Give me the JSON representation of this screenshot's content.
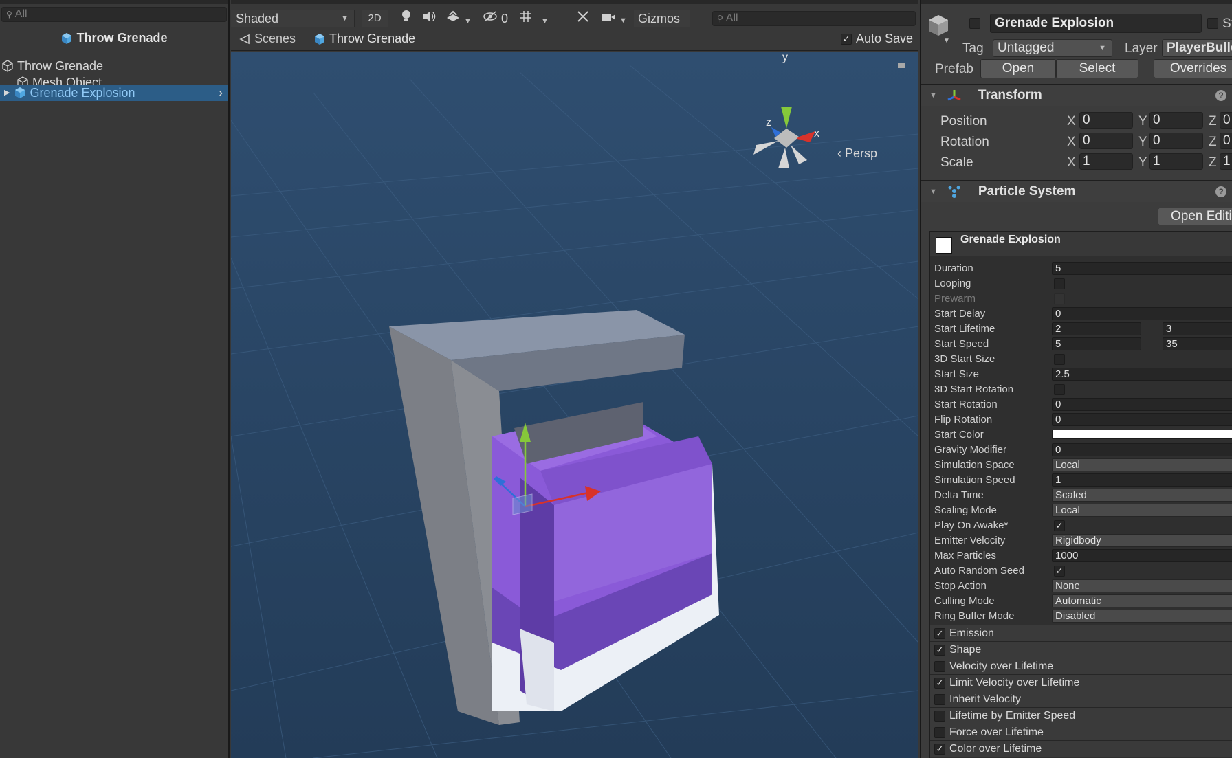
{
  "hierarchy": {
    "search_placeholder": "All",
    "prefab_title": "Throw Grenade",
    "items": [
      {
        "label": "Throw Grenade"
      },
      {
        "label": "Mesh Object"
      },
      {
        "label": "Grenade Explosion"
      }
    ]
  },
  "scene": {
    "shading_mode": "Shaded",
    "mode_2d": "2D",
    "hidden_count": "0",
    "gizmos_label": "Gizmos",
    "search_placeholder": "All",
    "breadcrumb": {
      "root": "Scenes",
      "current": "Throw Grenade"
    },
    "auto_save_label": "Auto Save",
    "projection_label": "Persp",
    "axis_labels": {
      "x": "x",
      "y": "y",
      "z": "z"
    }
  },
  "inspector": {
    "object_name": "Grenade Explosion",
    "static_label_partial": "St",
    "tag_label": "Tag",
    "tag_value": "Untagged",
    "layer_label": "Layer",
    "layer_value": "PlayerBulle",
    "prefab_label": "Prefab",
    "prefab_buttons": {
      "open": "Open",
      "select": "Select",
      "overrides": "Overrides"
    },
    "transform": {
      "title": "Transform",
      "rows": [
        {
          "label": "Position",
          "x": "0",
          "y": "0",
          "z": "0"
        },
        {
          "label": "Rotation",
          "x": "0",
          "y": "0",
          "z": "0"
        },
        {
          "label": "Scale",
          "x": "1",
          "y": "1",
          "z": "1"
        }
      ],
      "axis": {
        "x": "X",
        "y": "Y",
        "z": "Z"
      }
    },
    "particle_system": {
      "title": "Particle System",
      "open_editor": "Open Editi",
      "panel_title": "Grenade Explosion",
      "fields": {
        "duration": {
          "label": "Duration",
          "value": "5"
        },
        "looping": {
          "label": "Looping"
        },
        "prewarm": {
          "label": "Prewarm"
        },
        "start_delay": {
          "label": "Start Delay",
          "value": "0"
        },
        "start_lifetime": {
          "label": "Start Lifetime",
          "min": "2",
          "max": "3"
        },
        "start_speed": {
          "label": "Start Speed",
          "min": "5",
          "max": "35"
        },
        "start_size_3d": {
          "label": "3D Start Size"
        },
        "start_size": {
          "label": "Start Size",
          "value": "2.5"
        },
        "start_rotation_3d": {
          "label": "3D Start Rotation"
        },
        "start_rotation": {
          "label": "Start Rotation",
          "value": "0"
        },
        "flip_rotation": {
          "label": "Flip Rotation",
          "value": "0"
        },
        "start_color": {
          "label": "Start Color",
          "color": "#ffffff"
        },
        "gravity_modifier": {
          "label": "Gravity Modifier",
          "value": "0"
        },
        "simulation_space": {
          "label": "Simulation Space",
          "value": "Local"
        },
        "simulation_speed": {
          "label": "Simulation Speed",
          "value": "1"
        },
        "delta_time": {
          "label": "Delta Time",
          "value": "Scaled"
        },
        "scaling_mode": {
          "label": "Scaling Mode",
          "value": "Local"
        },
        "play_on_awake": {
          "label": "Play On Awake*"
        },
        "emitter_velocity": {
          "label": "Emitter Velocity",
          "value": "Rigidbody"
        },
        "max_particles": {
          "label": "Max Particles",
          "value": "1000"
        },
        "auto_random_seed": {
          "label": "Auto Random Seed"
        },
        "stop_action": {
          "label": "Stop Action",
          "value": "None"
        },
        "culling_mode": {
          "label": "Culling Mode",
          "value": "Automatic"
        },
        "ring_buffer_mode": {
          "label": "Ring Buffer Mode",
          "value": "Disabled"
        }
      },
      "modules": [
        {
          "label": "Emission",
          "enabled": true
        },
        {
          "label": "Shape",
          "enabled": true
        },
        {
          "label": "Velocity over Lifetime",
          "enabled": false
        },
        {
          "label": "Limit Velocity over Lifetime",
          "enabled": true
        },
        {
          "label": "Inherit Velocity",
          "enabled": false
        },
        {
          "label": "Lifetime by Emitter Speed",
          "enabled": false
        },
        {
          "label": "Force over Lifetime",
          "enabled": false
        },
        {
          "label": "Color over Lifetime",
          "enabled": true
        }
      ]
    }
  },
  "colors": {
    "selection": "#2c5d87",
    "viewport_bg": "#2c4a6b",
    "cube_purple": "#8a5ad8",
    "axis_x": "#d8322a",
    "axis_y": "#86c93a",
    "axis_z": "#2f6fd8"
  }
}
